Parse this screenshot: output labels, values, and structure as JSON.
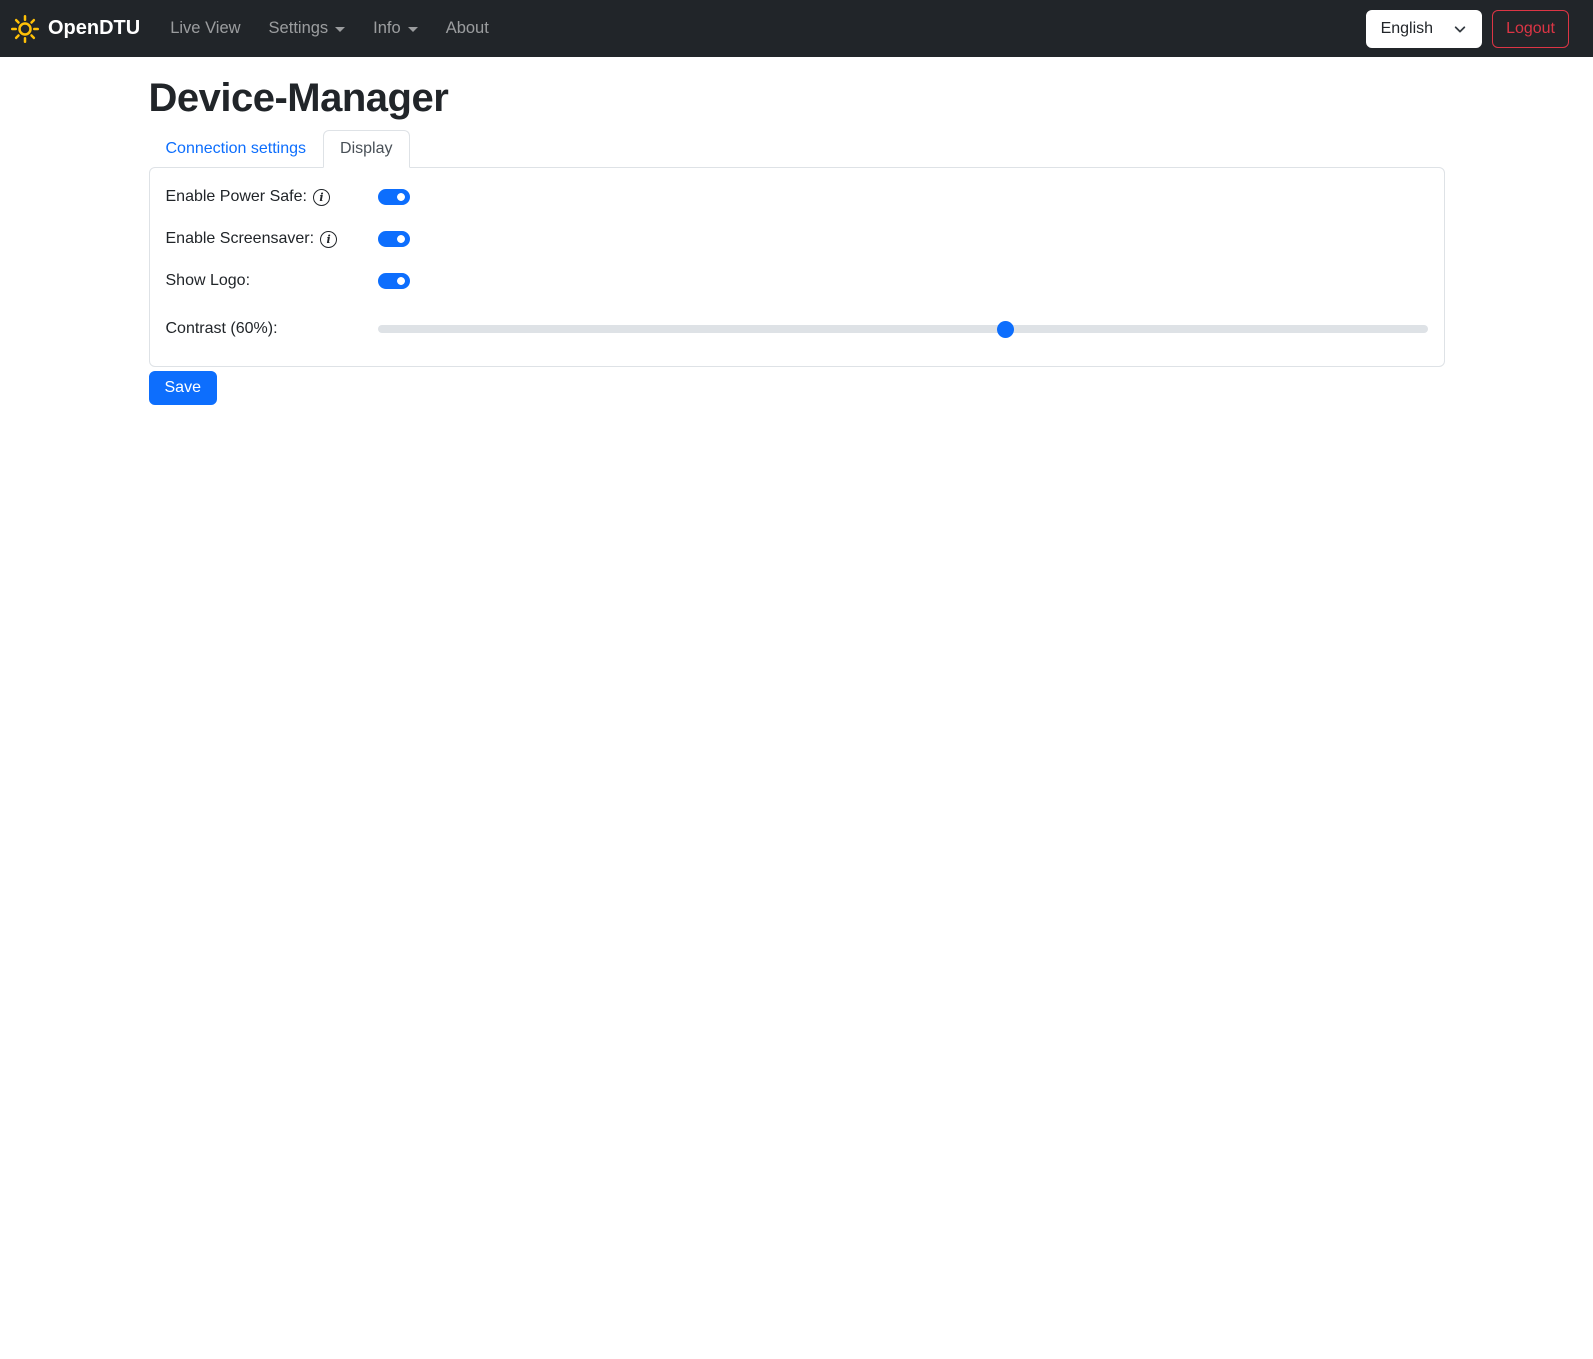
{
  "navbar": {
    "brand": "OpenDTU",
    "items": [
      {
        "label": "Live View",
        "has_dropdown": false
      },
      {
        "label": "Settings",
        "has_dropdown": true
      },
      {
        "label": "Info",
        "has_dropdown": true
      },
      {
        "label": "About",
        "has_dropdown": false
      }
    ],
    "language": {
      "selected": "English"
    },
    "logout_label": "Logout"
  },
  "page": {
    "title": "Device-Manager"
  },
  "tabs": [
    {
      "label": "Connection settings",
      "active": false
    },
    {
      "label": "Display",
      "active": true
    }
  ],
  "form": {
    "rows": [
      {
        "label": "Enable Power Safe:",
        "type": "toggle",
        "value": true,
        "info_icon": true
      },
      {
        "label": "Enable Screensaver:",
        "type": "toggle",
        "value": true,
        "info_icon": true
      },
      {
        "label": "Show Logo:",
        "type": "toggle",
        "value": true,
        "info_icon": false
      },
      {
        "label": "Contrast (60%):",
        "type": "range",
        "value": 60,
        "min": 0,
        "max": 100
      }
    ],
    "save_label": "Save"
  },
  "colors": {
    "accent": "#0d6efd",
    "navbar_bg": "#212529",
    "danger": "#dc3545",
    "border": "#dee2e6",
    "sun_icon": "#ffc107",
    "slider_track": "#dee2e6"
  }
}
